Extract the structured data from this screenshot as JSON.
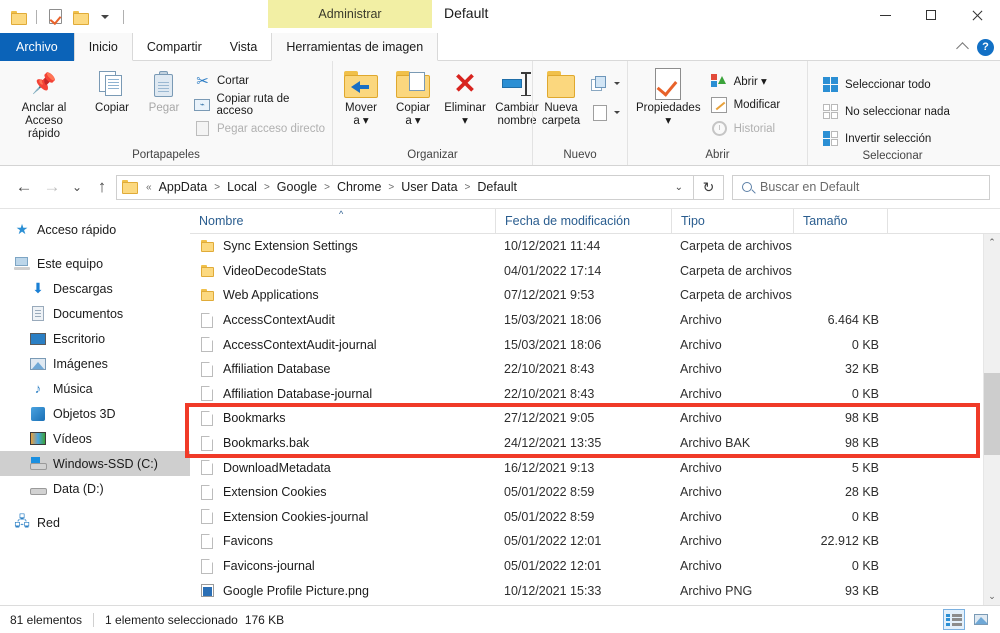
{
  "window": {
    "title": "Default",
    "contextual_tab_header": "Administrar",
    "minimize": "—",
    "maximize": "□",
    "close": "✕"
  },
  "quick_access_toolbar": {
    "items": [
      {
        "name": "folder-icon",
        "label": ""
      },
      {
        "name": "properties-icon",
        "label": ""
      },
      {
        "name": "new-folder-icon",
        "label": ""
      },
      {
        "name": "customize-dropdown-icon",
        "label": ""
      }
    ]
  },
  "tabs": [
    {
      "id": "archivo",
      "label": "Archivo"
    },
    {
      "id": "inicio",
      "label": "Inicio"
    },
    {
      "id": "compartir",
      "label": "Compartir"
    },
    {
      "id": "vista",
      "label": "Vista"
    },
    {
      "id": "herramientas-de-imagen",
      "label": "Herramientas de imagen"
    }
  ],
  "ribbon": {
    "collapse_label": "^",
    "help_label": "?",
    "groups": [
      {
        "id": "portapapeles",
        "label": "Portapapeles",
        "big_buttons": [
          {
            "id": "anclar",
            "label_line1": "Anclar al",
            "label_line2": "Acceso rápido",
            "icon": "pin-icon",
            "disabled": false
          },
          {
            "id": "copiar",
            "label_line1": "Copiar",
            "label_line2": "",
            "icon": "copy-icon",
            "disabled": false
          },
          {
            "id": "pegar",
            "label_line1": "Pegar",
            "label_line2": "",
            "icon": "paste-icon",
            "disabled": true
          }
        ],
        "small_buttons": [
          {
            "id": "cortar",
            "label": "Cortar",
            "icon": "scissors-icon",
            "disabled": false
          },
          {
            "id": "copiar-ruta",
            "label": "Copiar ruta de acceso",
            "icon": "copy-path-icon",
            "disabled": false
          },
          {
            "id": "pegar-acceso-directo",
            "label": "Pegar acceso directo",
            "icon": "paste-shortcut-icon",
            "disabled": true
          }
        ]
      },
      {
        "id": "organizar",
        "label": "Organizar",
        "big_buttons": [
          {
            "id": "mover-a",
            "label_line1": "Mover",
            "label_line2": "a ▾",
            "icon": "move-to-icon",
            "disabled": false
          },
          {
            "id": "copiar-a",
            "label_line1": "Copiar",
            "label_line2": "a ▾",
            "icon": "copy-to-icon",
            "disabled": false
          },
          {
            "id": "eliminar",
            "label_line1": "Eliminar",
            "label_line2": "▾",
            "icon": "delete-icon",
            "disabled": false
          },
          {
            "id": "cambiar-nombre",
            "label_line1": "Cambiar",
            "label_line2": "nombre",
            "icon": "rename-icon",
            "disabled": false
          }
        ],
        "small_buttons": []
      },
      {
        "id": "nuevo",
        "label": "Nuevo",
        "big_buttons": [
          {
            "id": "nueva-carpeta",
            "label_line1": "Nueva",
            "label_line2": "carpeta",
            "icon": "new-folder-icon",
            "disabled": false
          }
        ],
        "small_buttons": [
          {
            "id": "nuevo-elemento",
            "label": "",
            "icon": "new-item-icon",
            "disabled": false
          },
          {
            "id": "facil-acceso",
            "label": "",
            "icon": "easy-access-icon",
            "disabled": false
          }
        ]
      },
      {
        "id": "abrir",
        "label": "Abrir",
        "big_buttons": [
          {
            "id": "propiedades",
            "label_line1": "Propiedades",
            "label_line2": "▾",
            "icon": "properties-icon",
            "disabled": false
          }
        ],
        "small_buttons": [
          {
            "id": "abrir",
            "label": "Abrir ▾",
            "icon": "open-icon",
            "disabled": false
          },
          {
            "id": "modificar",
            "label": "Modificar",
            "icon": "edit-icon",
            "disabled": false
          },
          {
            "id": "historial",
            "label": "Historial",
            "icon": "history-icon",
            "disabled": true
          }
        ]
      },
      {
        "id": "seleccionar",
        "label": "Seleccionar",
        "big_buttons": [],
        "small_buttons": [
          {
            "id": "seleccionar-todo",
            "label": "Seleccionar todo",
            "icon": "select-all-icon",
            "disabled": false
          },
          {
            "id": "no-seleccionar-nada",
            "label": "No seleccionar nada",
            "icon": "select-none-icon",
            "disabled": false
          },
          {
            "id": "invertir-seleccion",
            "label": "Invertir selección",
            "icon": "invert-selection-icon",
            "disabled": false
          }
        ]
      }
    ]
  },
  "navigation": {
    "back": "←",
    "forward": "→",
    "recent": "⌄",
    "up": "↑",
    "refresh": "↻",
    "address_prefix": "«",
    "breadcrumbs": [
      "AppData",
      "Local",
      "Google",
      "Chrome",
      "User Data",
      "Default"
    ],
    "breadcrumb_sep": ">",
    "address_dropdown": "⌄"
  },
  "search": {
    "placeholder": "Buscar en Default",
    "value": ""
  },
  "sidebar": {
    "items": [
      {
        "id": "acceso-rapido",
        "label": "Acceso rápido",
        "icon": "star-icon",
        "indent": false,
        "selected": false
      },
      {
        "id": "este-equipo",
        "label": "Este equipo",
        "icon": "this-pc-icon",
        "indent": false,
        "selected": false
      },
      {
        "id": "descargas",
        "label": "Descargas",
        "icon": "downloads-icon",
        "indent": true,
        "selected": false
      },
      {
        "id": "documentos",
        "label": "Documentos",
        "icon": "documents-icon",
        "indent": true,
        "selected": false
      },
      {
        "id": "escritorio",
        "label": "Escritorio",
        "icon": "desktop-icon",
        "indent": true,
        "selected": false
      },
      {
        "id": "imagenes",
        "label": "Imágenes",
        "icon": "pictures-icon",
        "indent": true,
        "selected": false
      },
      {
        "id": "musica",
        "label": "Música",
        "icon": "music-icon",
        "indent": true,
        "selected": false
      },
      {
        "id": "objetos-3d",
        "label": "Objetos 3D",
        "icon": "3d-objects-icon",
        "indent": true,
        "selected": false
      },
      {
        "id": "videos",
        "label": "Vídeos",
        "icon": "videos-icon",
        "indent": true,
        "selected": false
      },
      {
        "id": "windows-ssd-c",
        "label": "Windows-SSD (C:)",
        "icon": "windows-drive-icon",
        "indent": true,
        "selected": true
      },
      {
        "id": "data-d",
        "label": "Data (D:)",
        "icon": "drive-icon",
        "indent": true,
        "selected": false
      },
      {
        "id": "red",
        "label": "Red",
        "icon": "network-icon",
        "indent": false,
        "selected": false
      }
    ]
  },
  "filelist": {
    "columns": [
      {
        "id": "nombre",
        "label": "Nombre",
        "sorted": true,
        "sort_dir": "asc",
        "sort_glyph": "^"
      },
      {
        "id": "fecha",
        "label": "Fecha de modificación",
        "sorted": false
      },
      {
        "id": "tipo",
        "label": "Tipo",
        "sorted": false
      },
      {
        "id": "tamano",
        "label": "Tamaño",
        "sorted": false
      }
    ],
    "rows": [
      {
        "name": "Sync Extension Settings",
        "date": "10/12/2021 11:44",
        "type": "Carpeta de archivos",
        "size": "",
        "icon": "folder-icon",
        "highlighted": false
      },
      {
        "name": "VideoDecodeStats",
        "date": "04/01/2022 17:14",
        "type": "Carpeta de archivos",
        "size": "",
        "icon": "folder-icon",
        "highlighted": false
      },
      {
        "name": "Web Applications",
        "date": "07/12/2021 9:53",
        "type": "Carpeta de archivos",
        "size": "",
        "icon": "folder-icon",
        "highlighted": false
      },
      {
        "name": "AccessContextAudit",
        "date": "15/03/2021 18:06",
        "type": "Archivo",
        "size": "6.464 KB",
        "icon": "file-icon",
        "highlighted": false
      },
      {
        "name": "AccessContextAudit-journal",
        "date": "15/03/2021 18:06",
        "type": "Archivo",
        "size": "0 KB",
        "icon": "file-icon",
        "highlighted": false
      },
      {
        "name": "Affiliation Database",
        "date": "22/10/2021 8:43",
        "type": "Archivo",
        "size": "32 KB",
        "icon": "file-icon",
        "highlighted": false
      },
      {
        "name": "Affiliation Database-journal",
        "date": "22/10/2021 8:43",
        "type": "Archivo",
        "size": "0 KB",
        "icon": "file-icon",
        "highlighted": false
      },
      {
        "name": "Bookmarks",
        "date": "27/12/2021 9:05",
        "type": "Archivo",
        "size": "98 KB",
        "icon": "file-icon",
        "highlighted": true
      },
      {
        "name": "Bookmarks.bak",
        "date": "24/12/2021 13:35",
        "type": "Archivo BAK",
        "size": "98 KB",
        "icon": "file-icon",
        "highlighted": true
      },
      {
        "name": "DownloadMetadata",
        "date": "16/12/2021 9:13",
        "type": "Archivo",
        "size": "5 KB",
        "icon": "file-icon",
        "highlighted": false
      },
      {
        "name": "Extension Cookies",
        "date": "05/01/2022 8:59",
        "type": "Archivo",
        "size": "28 KB",
        "icon": "file-icon",
        "highlighted": false
      },
      {
        "name": "Extension Cookies-journal",
        "date": "05/01/2022 8:59",
        "type": "Archivo",
        "size": "0 KB",
        "icon": "file-icon",
        "highlighted": false
      },
      {
        "name": "Favicons",
        "date": "05/01/2022 12:01",
        "type": "Archivo",
        "size": "22.912 KB",
        "icon": "file-icon",
        "highlighted": false
      },
      {
        "name": "Favicons-journal",
        "date": "05/01/2022 12:01",
        "type": "Archivo",
        "size": "0 KB",
        "icon": "file-icon",
        "highlighted": false
      },
      {
        "name": "Google Profile Picture.png",
        "date": "10/12/2021 15:33",
        "type": "Archivo PNG",
        "size": "93 KB",
        "icon": "png-icon",
        "highlighted": false
      }
    ],
    "scroll_up": "⌃",
    "scroll_down": "⌄"
  },
  "annotation": {
    "color": "#f03a28",
    "target_rows": [
      "Bookmarks",
      "Bookmarks.bak"
    ]
  },
  "statusbar": {
    "item_count": "81 elementos",
    "selected_text": "1 elemento seleccionado",
    "selected_size": "176 KB",
    "view_buttons": [
      {
        "id": "detalles",
        "name": "details-view-button",
        "active": true
      },
      {
        "id": "iconos-grandes",
        "name": "large-icons-view-button",
        "active": false
      }
    ]
  }
}
